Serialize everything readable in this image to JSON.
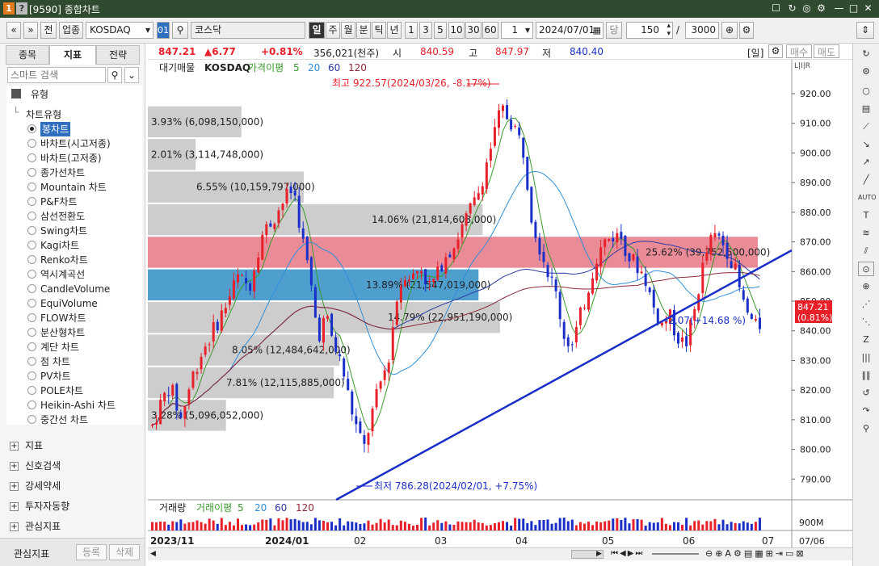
{
  "window": {
    "badge1": "1",
    "badge2": "?",
    "title": "[9590] 종합차트",
    "controls": [
      "☐",
      "↻",
      "◎",
      "⚙",
      "—",
      "□",
      "✕"
    ]
  },
  "toolbar": {
    "nav_prev": "«",
    "nav_down": "»",
    "btn_jeon": "전",
    "btn_upjong": "업종",
    "market_select": "KOSDAQ",
    "code_box": "01",
    "search_icon": "⚲",
    "name_field": "코스닥",
    "periods": [
      "일",
      "주",
      "월",
      "분",
      "틱",
      "년"
    ],
    "intervals": [
      "1",
      "3",
      "5",
      "10",
      "30",
      "60"
    ],
    "count_select": "1",
    "date_field": "2024/07/01",
    "btn_dang": "당",
    "bars_value": "150",
    "slash": "/",
    "total_value": "3000"
  },
  "pricebar": {
    "price": "847.21",
    "change": "▲6.77",
    "pct": "+0.81%",
    "volume": "356,021(천주)",
    "open_label": "시",
    "open": "840.59",
    "high_label": "고",
    "high": "847.97",
    "low_label": "저",
    "low": "840.40",
    "period_label": "[일]",
    "btn_buy": "매수",
    "btn_sell": "매도"
  },
  "leftpanel": {
    "tabs": [
      "종목",
      "지표",
      "전략"
    ],
    "search_placeholder": "스마트 검색",
    "section_type": "유형",
    "chart_type_header": "차트유형",
    "chart_types": [
      "봉차트",
      "바차트(시고저종)",
      "바차트(고저종)",
      "종가선차트",
      "Mountain 차트",
      "P&F차트",
      "삼선전환도",
      "Swing차트",
      "Kagi차트",
      "Renko차트",
      "역시계곡선",
      "CandleVolume",
      "EquiVolume",
      "FLOW차트",
      "분산형차트",
      "계단 차트",
      "점 차트",
      "PV차트",
      "POLE차트",
      "Heikin-Ashi 차트",
      "중간선 차트"
    ],
    "sections": [
      "지표",
      "신호검색",
      "강세약세",
      "투자자동향",
      "관심지표"
    ],
    "bottom_label": "관심지표",
    "btn_register": "등록",
    "btn_delete": "삭제"
  },
  "chart": {
    "legend": {
      "title": "대기매물",
      "symbol": "KOSDAQ",
      "ma_label": "가격이평",
      "ma_periods": [
        "5",
        "20",
        "60",
        "120"
      ]
    },
    "high_note": "최고 922.57(2024/03/26, -8.17%)",
    "low_note": "최저 786.28(2024/02/01, +7.75%)",
    "trend_note": "-2.07(+14.68 %)",
    "current_price_tag": "847.21",
    "current_pct_tag": "(0.81%)",
    "y_ticks": [
      "920.00",
      "910.00",
      "900.00",
      "890.00",
      "880.00",
      "870.00",
      "860.00",
      "850.00",
      "840.00",
      "830.00",
      "820.00",
      "810.00",
      "800.00",
      "790.00"
    ],
    "volume_profile": [
      {
        "label": "3.93% (6,098,150,000)",
        "price": 910.5,
        "pct": 3.93
      },
      {
        "label": "2.01% (3,114,748,000)",
        "price": 899.5,
        "pct": 2.01
      },
      {
        "label": "6.55% (10,159,797,000)",
        "price": 888.5,
        "pct": 6.55
      },
      {
        "label": "14.06% (21,814,608,000)",
        "price": 877.5,
        "pct": 14.06
      },
      {
        "label": "25.62% (39,752,500,000)",
        "price": 866.5,
        "pct": 25.62
      },
      {
        "label": "13.89% (21,547,019,000)",
        "price": 855.5,
        "pct": 13.89
      },
      {
        "label": "14.79% (22,951,190,000)",
        "price": 844.5,
        "pct": 14.79
      },
      {
        "label": "8.05% (12,484,642,000)",
        "price": 833.5,
        "pct": 8.05
      },
      {
        "label": "7.81% (12,115,885,000)",
        "price": 822.5,
        "pct": 7.81
      },
      {
        "label": "3.28% (5,096,052,000)",
        "price": 811.5,
        "pct": 3.28
      }
    ],
    "volume_legend": {
      "title": "거래량",
      "ma_label": "거래이평",
      "ma_periods": [
        "5",
        "20",
        "60",
        "120"
      ]
    },
    "volume_tick": "900M",
    "x_labels": [
      "2023/11",
      "2024/01",
      "02",
      "03",
      "04",
      "05",
      "06",
      "07"
    ],
    "x_right_label": "07/06"
  },
  "colors": {
    "up": "#e8202a",
    "down": "#1a2fc8",
    "ma5": "#3c9a2e",
    "ma20": "#2f8fd8",
    "ma60": "#2a3aa0",
    "ma120": "#8a2a3a",
    "profile_gray": "#c8c8c8",
    "profile_max": "#e87f8c",
    "profile_cur": "#3b93c9"
  }
}
